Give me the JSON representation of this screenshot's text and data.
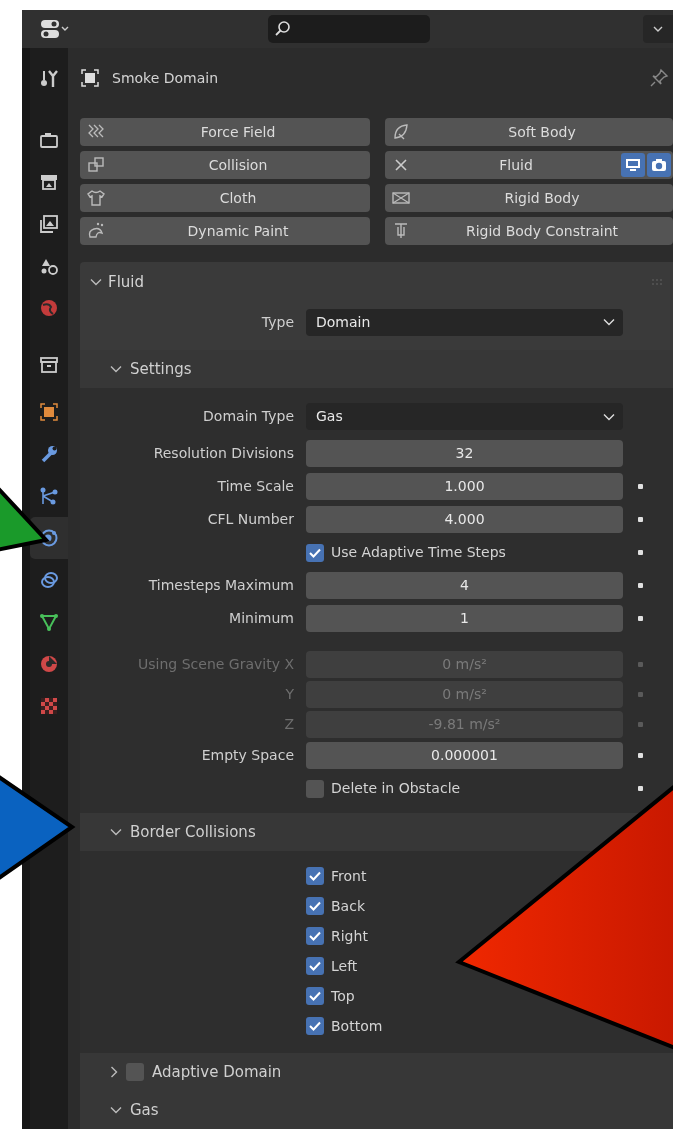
{
  "sidebar_tabs": [
    {
      "selected": false
    },
    {
      "selected": false
    },
    {
      "selected": false
    },
    {
      "selected": false
    },
    {
      "selected": false
    },
    {
      "selected": false
    },
    {
      "selected": false
    },
    {
      "selected": false
    },
    {
      "selected": false
    },
    {
      "selected": false
    },
    {
      "selected": true
    },
    {
      "selected": false
    },
    {
      "selected": false
    },
    {
      "selected": false
    },
    {
      "selected": false
    }
  ],
  "object": {
    "name": "Smoke Domain"
  },
  "physics": [
    {
      "label": "Force Field",
      "enabled": false
    },
    {
      "label": "Soft Body",
      "enabled": false
    },
    {
      "label": "Collision",
      "enabled": false
    },
    {
      "label": "Fluid",
      "enabled": true
    },
    {
      "label": "Cloth",
      "enabled": false
    },
    {
      "label": "Rigid Body",
      "enabled": false
    },
    {
      "label": "Dynamic Paint",
      "enabled": false
    },
    {
      "label": "Rigid Body Constraint",
      "enabled": false
    }
  ],
  "fluid_panel": {
    "title": "Fluid",
    "expanded": true,
    "type": {
      "label": "Type",
      "value": "Domain"
    },
    "subpanels": [
      {
        "title": "Settings",
        "expanded": true,
        "rows": [
          {
            "kind": "dropdown",
            "label": "Domain Type",
            "value": "Gas",
            "disabled": false,
            "animatable": false
          },
          {
            "kind": "number",
            "label": "Resolution Divisions",
            "value": "32",
            "disabled": false,
            "animatable": false
          },
          {
            "kind": "number",
            "label": "Time Scale",
            "value": "1.000",
            "disabled": false,
            "animatable": true
          },
          {
            "kind": "number",
            "label": "CFL Number",
            "value": "4.000",
            "disabled": false,
            "animatable": true
          },
          {
            "kind": "checkbox",
            "label": "Use Adaptive Time Steps",
            "checked": true,
            "disabled": false,
            "animatable": true
          },
          {
            "kind": "number",
            "label": "Timesteps Maximum",
            "value": "4",
            "disabled": false,
            "animatable": true
          },
          {
            "kind": "number",
            "label": "Minimum",
            "value": "1",
            "disabled": false,
            "animatable": true
          },
          {
            "kind": "number",
            "label": "Using Scene Gravity X",
            "value": "0 m/s²",
            "disabled": true,
            "animatable": true
          },
          {
            "kind": "number",
            "label": "Y",
            "value": "0 m/s²",
            "disabled": true,
            "animatable": true
          },
          {
            "kind": "number",
            "label": "Z",
            "value": "-9.81 m/s²",
            "disabled": true,
            "animatable": true
          },
          {
            "kind": "number",
            "label": "Empty Space",
            "value": "0.000001",
            "disabled": false,
            "animatable": true
          },
          {
            "kind": "checkbox",
            "label": "Delete in Obstacle",
            "checked": false,
            "disabled": false,
            "animatable": true
          }
        ]
      },
      {
        "title": "Border Collisions",
        "expanded": true,
        "rows": [
          {
            "kind": "checkbox",
            "label": "Front",
            "checked": true,
            "disabled": false,
            "animatable": false
          },
          {
            "kind": "checkbox",
            "label": "Back",
            "checked": true,
            "disabled": false,
            "animatable": false
          },
          {
            "kind": "checkbox",
            "label": "Right",
            "checked": true,
            "disabled": false,
            "animatable": false
          },
          {
            "kind": "checkbox",
            "label": "Left",
            "checked": true,
            "disabled": false,
            "animatable": false
          },
          {
            "kind": "checkbox",
            "label": "Top",
            "checked": true,
            "disabled": false,
            "animatable": false
          },
          {
            "kind": "checkbox",
            "label": "Bottom",
            "checked": true,
            "disabled": false,
            "animatable": false
          }
        ]
      },
      {
        "title": "Adaptive Domain",
        "expanded": false,
        "toggle": {
          "checked": false
        }
      },
      {
        "title": "Gas",
        "expanded": true
      }
    ]
  }
}
